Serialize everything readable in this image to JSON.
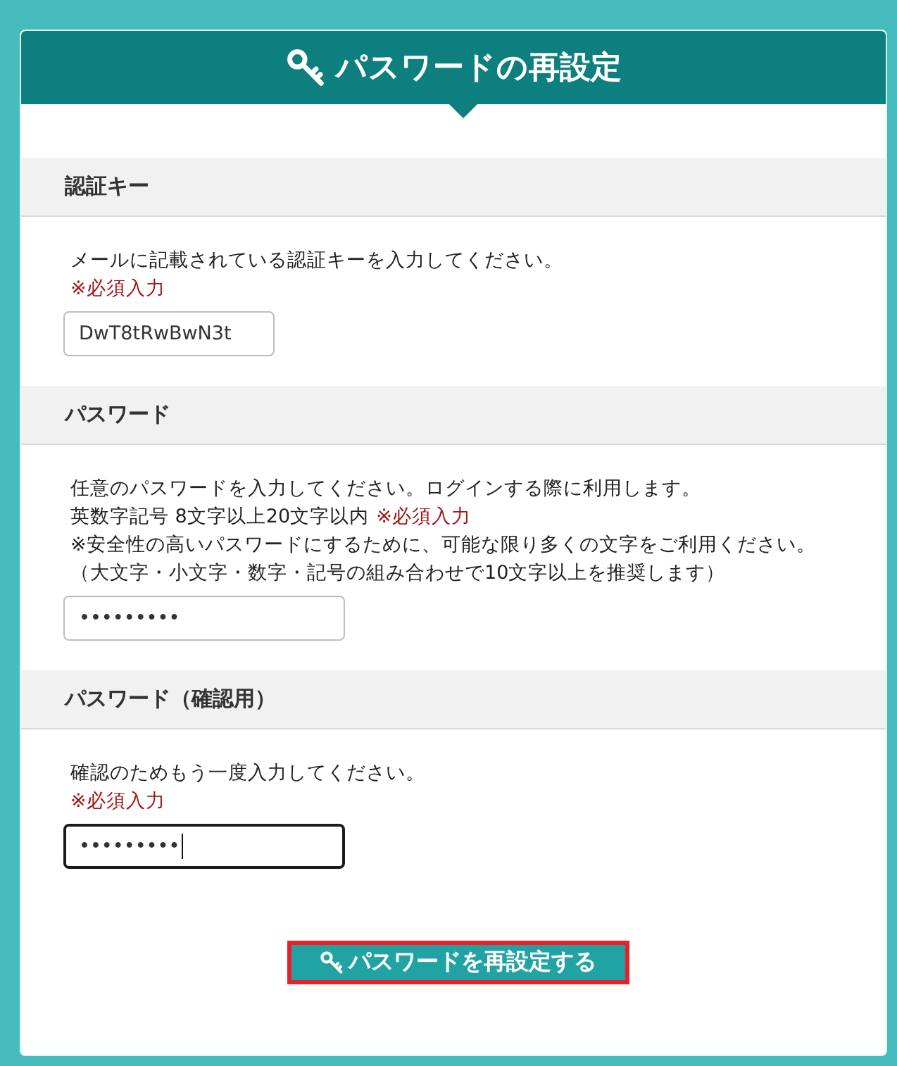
{
  "header": {
    "title": "パスワードの再設定"
  },
  "sections": [
    {
      "label": "認証キー",
      "lines": [
        [
          {
            "kind": "text",
            "text": "メールに記載されている認証キーを入力してください。"
          }
        ],
        [
          {
            "kind": "required",
            "text": "※必須入力"
          }
        ]
      ],
      "field": {
        "kind": "text",
        "value": "DwT8tRwBwN3t",
        "focused": false
      }
    },
    {
      "label": "パスワード",
      "lines": [
        [
          {
            "kind": "text",
            "text": "任意のパスワードを入力してください。ログインする際に利用します。"
          }
        ],
        [
          {
            "kind": "text",
            "text": "英数字記号 8文字以上20文字以内"
          },
          {
            "kind": "required",
            "text": "※必須入力"
          }
        ],
        [
          {
            "kind": "text",
            "text": "※安全性の高いパスワードにするために、可能な限り多くの文字をご利用ください。"
          }
        ],
        [
          {
            "kind": "text",
            "text": "（大文字・小文字・数字・記号の組み合わせで10文字以上を推奨します）"
          }
        ]
      ],
      "field": {
        "kind": "password",
        "value": "•••••••••",
        "focused": false
      }
    },
    {
      "label": "パスワード（確認用）",
      "lines": [
        [
          {
            "kind": "text",
            "text": "確認のためもう一度入力してください。"
          }
        ],
        [
          {
            "kind": "required",
            "text": "※必須入力"
          }
        ]
      ],
      "field": {
        "kind": "password",
        "value": "•••••••••",
        "focused": true
      }
    }
  ],
  "submit_button": {
    "label": "パスワードを再設定する",
    "focused": true
  }
}
